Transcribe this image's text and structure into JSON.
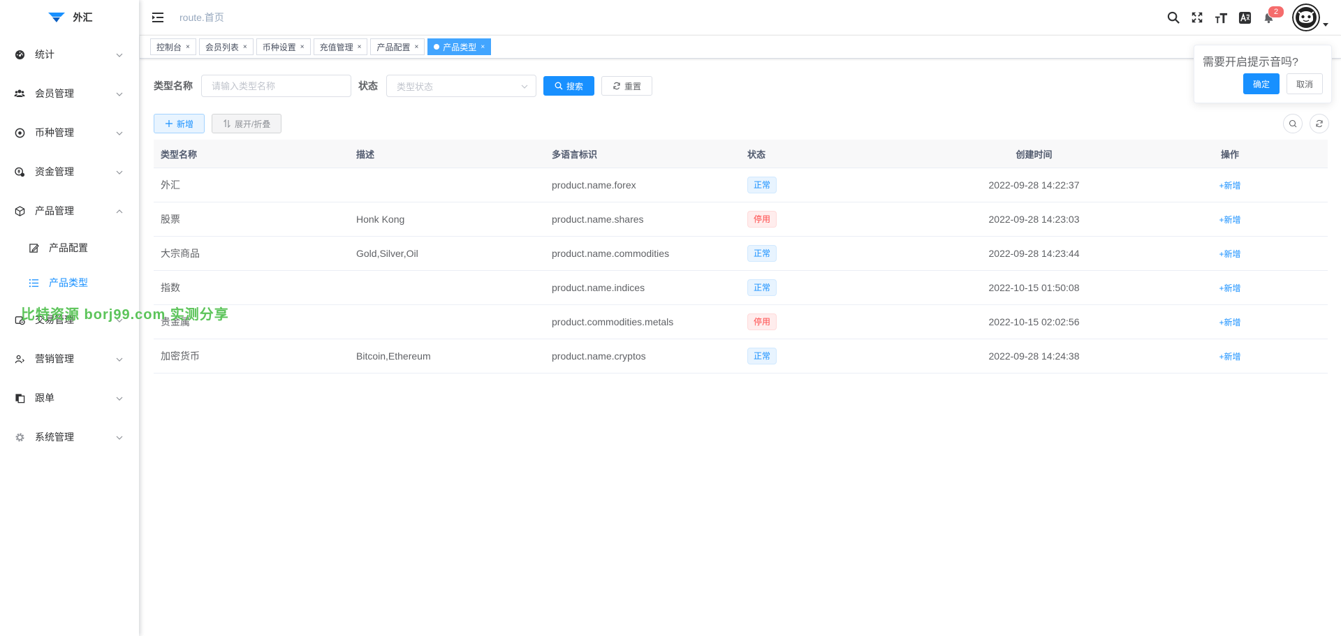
{
  "app": {
    "logo_text": "外汇"
  },
  "sidebar": {
    "items": [
      {
        "label": "统计",
        "icon": "dashboard-icon"
      },
      {
        "label": "会员管理",
        "icon": "users-icon"
      },
      {
        "label": "币种管理",
        "icon": "coin-icon"
      },
      {
        "label": "资金管理",
        "icon": "money-icon"
      },
      {
        "label": "产品管理",
        "icon": "cube-icon",
        "expanded": true
      },
      {
        "label": "交易管理",
        "icon": "trade-icon"
      },
      {
        "label": "营销管理",
        "icon": "marketing-icon"
      },
      {
        "label": "跟单",
        "icon": "copy-icon"
      },
      {
        "label": "系统管理",
        "icon": "gear-icon"
      }
    ],
    "sub_items": [
      {
        "label": "产品配置",
        "icon": "edit-icon"
      },
      {
        "label": "产品类型",
        "icon": "list-icon",
        "active": true
      }
    ]
  },
  "header": {
    "breadcrumb": "route.首页",
    "notification_count": "2"
  },
  "tags": [
    {
      "label": "控制台"
    },
    {
      "label": "会员列表"
    },
    {
      "label": "币种设置"
    },
    {
      "label": "充值管理"
    },
    {
      "label": "产品配置"
    },
    {
      "label": "产品类型",
      "active": true
    }
  ],
  "tag_close": "×",
  "search": {
    "name_label": "类型名称",
    "name_placeholder": "请输入类型名称",
    "status_label": "状态",
    "status_placeholder": "类型状态",
    "search_button": "搜索",
    "reset_button": "重置"
  },
  "toolbar": {
    "add_button": "新增",
    "expand_button": "展开/折叠"
  },
  "table": {
    "columns": [
      "类型名称",
      "描述",
      "多语言标识",
      "状态",
      "创建时间",
      "操作"
    ],
    "rows": [
      {
        "name": "外汇",
        "desc": "",
        "i18n": "product.name.forex",
        "status": "正常",
        "status_type": "ok",
        "created": "2022-09-28 14:22:37",
        "op": "新增"
      },
      {
        "name": "股票",
        "desc": "Honk Kong",
        "i18n": "product.name.shares",
        "status": "停用",
        "status_type": "off",
        "created": "2022-09-28 14:23:03",
        "op": "新增"
      },
      {
        "name": "大宗商品",
        "desc": "Gold,Silver,Oil",
        "i18n": "product.name.commodities",
        "status": "正常",
        "status_type": "ok",
        "created": "2022-09-28 14:23:44",
        "op": "新增"
      },
      {
        "name": "指数",
        "desc": "",
        "i18n": "product.name.indices",
        "status": "正常",
        "status_type": "ok",
        "created": "2022-10-15 01:50:08",
        "op": "新增"
      },
      {
        "name": "贵金属",
        "desc": "",
        "i18n": "product.commodities.metals",
        "status": "停用",
        "status_type": "off",
        "created": "2022-10-15 02:02:56",
        "op": "新增"
      },
      {
        "name": "加密货币",
        "desc": "Bitcoin,Ethereum",
        "i18n": "product.name.cryptos",
        "status": "正常",
        "status_type": "ok",
        "created": "2022-09-28 14:24:38",
        "op": "新增"
      }
    ]
  },
  "popover": {
    "message": "需要开启提示音吗?",
    "confirm": "确定",
    "cancel": "取消"
  },
  "watermark": {
    "text": "比特资源 borj99.com 实测分享"
  },
  "colors": {
    "primary": "#1890ff",
    "danger": "#ff4949",
    "badge": "#f56c6c",
    "watermark": "#5cc45a"
  }
}
